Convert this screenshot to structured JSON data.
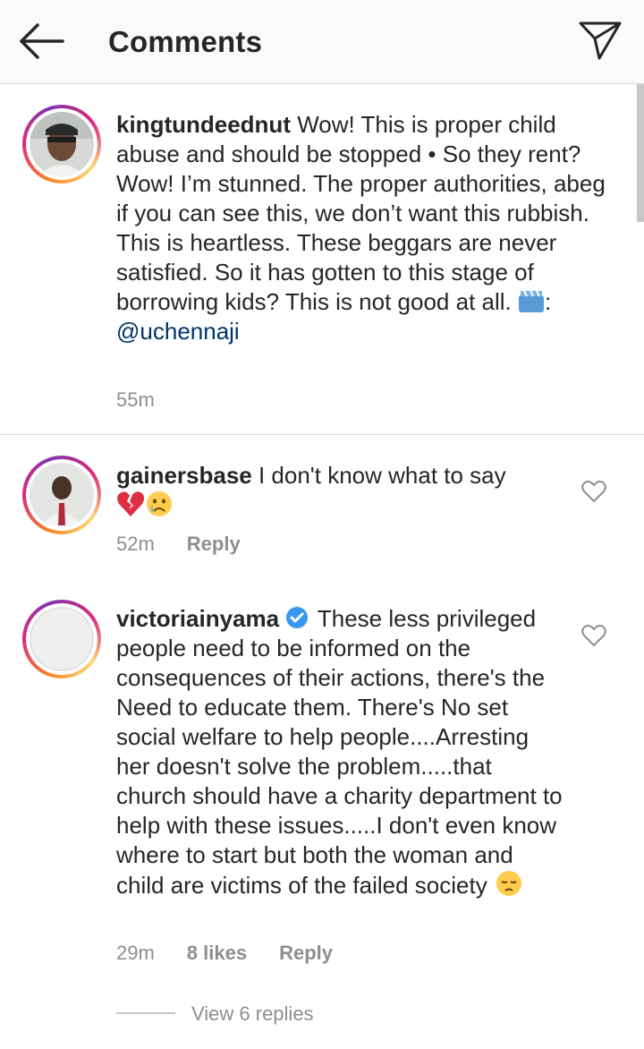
{
  "header": {
    "title": "Comments",
    "back_icon": "arrow-left-icon",
    "send_icon": "paper-plane-icon"
  },
  "comments": [
    {
      "username": "kingtundeednut",
      "text_before_icon": " Wow! This is proper child abuse and should be stopped • So they rent? Wow! I’m stunned. The proper authorities, abeg if you can see this, we don’t want this rubbish. This is heartless. These beggars are never satisfied. So it has gotten to this stage of borrowing kids? This is not good at all. ",
      "camera_emoji": "video-camera-emoji",
      "text_after_icon": ": ",
      "mention": "@uchennaji",
      "time": "55m"
    },
    {
      "username": "gainersbase",
      "text": " I don't know what to say",
      "emojis": [
        "💔",
        "😢"
      ],
      "time": "52m",
      "reply_label": "Reply"
    },
    {
      "username": "victoriainyama",
      "verified_icon": "verified-badge-icon",
      "text": " These less privileged people need to be informed on the consequences of their actions, there's the Need to educate them. There's No set social welfare to help people....Arresting her doesn't solve the problem.....that church should have a charity department to help with these issues.....I don't even know where to start but both the woman and child are victims of the failed society ",
      "emoji": "😔",
      "time": "29m",
      "likes": "8 likes",
      "reply_label": "Reply",
      "view_replies": "View 6 replies"
    }
  ],
  "colors": {
    "text": "#262626",
    "secondary": "#8e8e8e",
    "mention": "#003569",
    "verified": "#3897f0",
    "header_bg": "#fafafa"
  }
}
